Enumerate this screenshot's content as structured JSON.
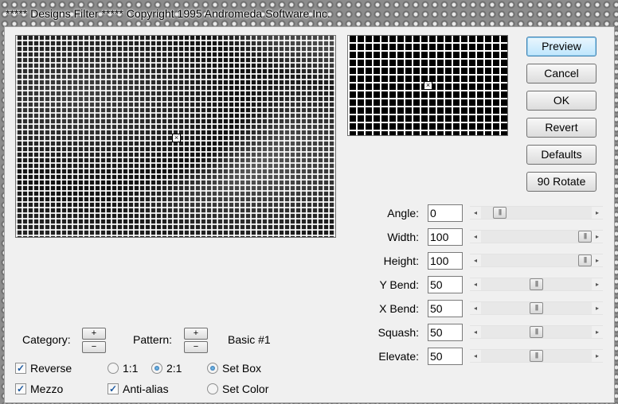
{
  "title": "***** Designs Filter *****  Copyright 1995 Andromeda Software Inc.",
  "buttons": {
    "preview": "Preview",
    "cancel": "Cancel",
    "ok": "OK",
    "revert": "Revert",
    "defaults": "Defaults",
    "rotate90": "90 Rotate"
  },
  "params": [
    {
      "label": "Angle:",
      "value": "0",
      "slider_fraction": 0.12
    },
    {
      "label": "Width:",
      "value": "100",
      "slider_fraction": 1.0
    },
    {
      "label": "Height:",
      "value": "100",
      "slider_fraction": 1.0
    },
    {
      "label": "Y Bend:",
      "value": "50",
      "slider_fraction": 0.5
    },
    {
      "label": "X Bend:",
      "value": "50",
      "slider_fraction": 0.5
    },
    {
      "label": "Squash:",
      "value": "50",
      "slider_fraction": 0.5
    },
    {
      "label": "Elevate:",
      "value": "50",
      "slider_fraction": 0.5
    }
  ],
  "category_label": "Category:",
  "pattern_label": "Pattern:",
  "pattern_name": "Basic #1",
  "spin": {
    "plus": "+",
    "minus": "−"
  },
  "checkboxes": {
    "reverse": {
      "label": "Reverse",
      "checked": true
    },
    "mezzo": {
      "label": "Mezzo",
      "checked": true
    },
    "antialias": {
      "label": "Anti-alias",
      "checked": true
    }
  },
  "ratio_options": {
    "one_to_one": {
      "label": "1:1",
      "selected": false
    },
    "two_to_one": {
      "label": "2:1",
      "selected": true
    }
  },
  "set_options": {
    "set_box": {
      "label": "Set Box",
      "selected": true
    },
    "set_color": {
      "label": "Set Color",
      "selected": false
    }
  },
  "icons": {
    "crosshair": "crosshair-icon",
    "check": "✓"
  }
}
